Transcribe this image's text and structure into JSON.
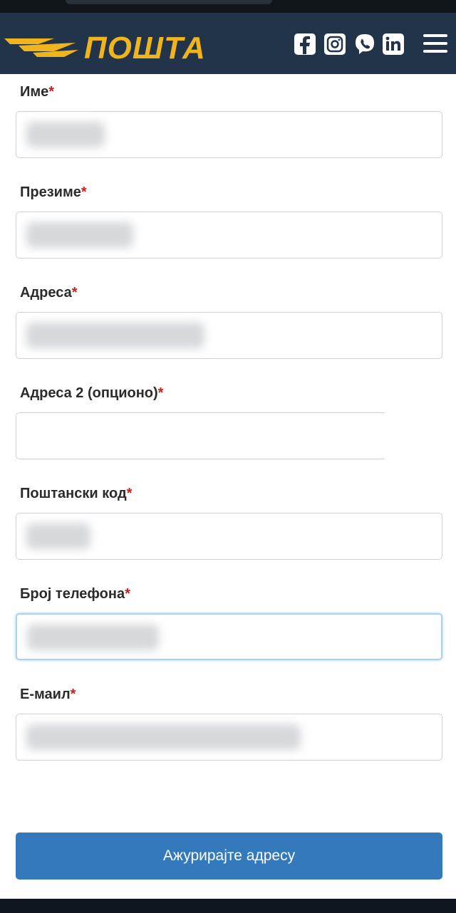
{
  "header": {
    "logo_text": "ПОШТА",
    "social_icons": [
      "facebook-icon",
      "instagram-icon",
      "viber-icon",
      "linkedin-icon"
    ],
    "colors": {
      "bar": "#22344a",
      "logo": "#f0b41c"
    }
  },
  "form": {
    "fields": [
      {
        "label": "Име",
        "required_mark": "*"
      },
      {
        "label": "Презиме",
        "required_mark": "*"
      },
      {
        "label": "Адреса",
        "required_mark": "*"
      },
      {
        "label": "Адреса 2 (опционо)",
        "required_mark": "*"
      },
      {
        "label": "Поштански код",
        "required_mark": "*"
      },
      {
        "label": "Број телефона",
        "required_mark": "*"
      },
      {
        "label": "Е-маил",
        "required_mark": "*"
      }
    ],
    "submit_label": "Ажурирајте адресу",
    "colors": {
      "button": "#3579bd",
      "required": "#c8201c",
      "focus": "#a9d2ee"
    }
  }
}
